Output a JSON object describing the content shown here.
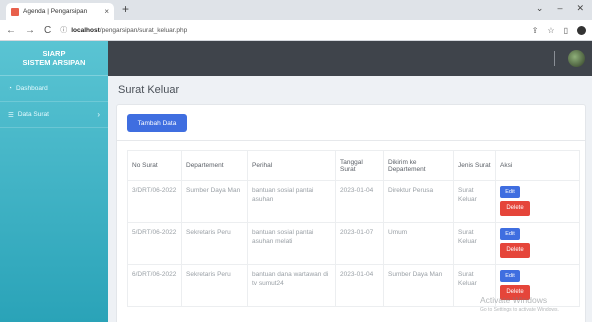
{
  "browser": {
    "tab_title": "Agenda | Pengarsipan",
    "tab_close": "×",
    "new_tab": "+",
    "url_host": "localhost",
    "url_path": "/pengarsipan/surat_keluar.php",
    "controls": {
      "minimize": "–",
      "restore": "⌄",
      "close": "✕"
    }
  },
  "sidebar": {
    "brand_line1": "SIARP",
    "brand_line2": "SISTEM ARSIPAN",
    "items": [
      {
        "label": "Dashboard",
        "icon": "gauge-icon"
      },
      {
        "label": "Data Surat",
        "icon": "list-icon",
        "chevron": "›"
      }
    ]
  },
  "main": {
    "title": "Surat Keluar",
    "add_button": "Tambah Data",
    "table": {
      "headers": [
        "No Surat",
        "Departement",
        "Perihal",
        "Tanggal Surat",
        "Dikirim ke Departement",
        "Jenis Surat",
        "Aksi"
      ],
      "rows": [
        [
          "3/DRT/06-2022",
          "Sumber Daya Man",
          "bantuan sosial pantai asuhan",
          "2023-01-04",
          "Direktur Perusa",
          "Surat Keluar"
        ],
        [
          "5/DRT/06-2022",
          "Sekretaris Peru",
          "bantuan sosial pantai asuhan melati",
          "2023-01-07",
          "Umum",
          "Surat Keluar"
        ],
        [
          "6/DRT/06-2022",
          "Sekretaris Peru",
          "bantuan dana wartawan di tv sumut24",
          "2023-01-04",
          "Sumber Daya Man",
          "Surat Keluar"
        ]
      ],
      "edit_label": "Edit",
      "delete_label": "Delete"
    }
  },
  "watermark": {
    "line1": "Activate Windows",
    "line2": "Go to Settings to activate Windows."
  },
  "colors": {
    "sidebar_top": "#5ac4d3",
    "sidebar_bottom": "#2aa3b8",
    "topbar": "#3f444b",
    "primary": "#3f6ee0",
    "danger": "#e5453a"
  }
}
